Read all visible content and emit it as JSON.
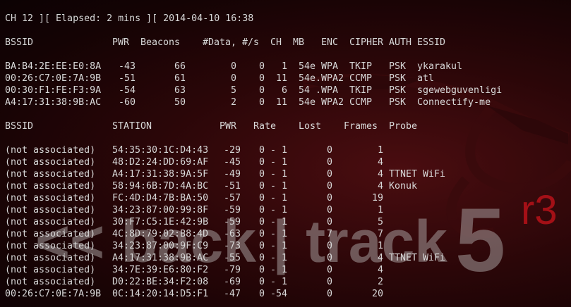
{
  "status_line": "CH 12 ][ Elapsed: 2 mins ][ 2014-04-10 16:38",
  "ap_table": {
    "headers": [
      "BSSID",
      "PWR",
      "Beacons",
      "#Data,",
      "#/s",
      "CH",
      "MB",
      "ENC",
      "CIPHER",
      "AUTH",
      "ESSID"
    ],
    "rows": [
      [
        "BA:B4:2E:EE:E0:8A",
        "-43",
        "66",
        "0",
        "0",
        "1",
        "54e",
        "WPA",
        "TKIP",
        "PSK",
        "ykarakul"
      ],
      [
        "00:26:C7:0E:7A:9B",
        "-51",
        "61",
        "0",
        "0",
        "11",
        "54e.",
        "WPA2",
        "CCMP",
        "PSK",
        "atl"
      ],
      [
        "00:30:F1:FE:F3:9A",
        "-54",
        "63",
        "5",
        "0",
        "6",
        "54 .",
        "WPA",
        "TKIP",
        "PSK",
        "sgewebguvenligi"
      ],
      [
        "A4:17:31:38:9B:AC",
        "-60",
        "50",
        "2",
        "0",
        "11",
        "54e",
        "WPA2",
        "CCMP",
        "PSK",
        "Connectify-me"
      ]
    ]
  },
  "station_table": {
    "headers": [
      "BSSID",
      "STATION",
      "PWR",
      "Rate",
      "Lost",
      "Frames",
      "Probe"
    ],
    "rows": [
      [
        "(not associated)",
        "54:35:30:1C:D4:43",
        "-29",
        "0 - 1",
        "0",
        "1",
        ""
      ],
      [
        "(not associated)",
        "48:D2:24:DD:69:AF",
        "-45",
        "0 - 1",
        "0",
        "4",
        ""
      ],
      [
        "(not associated)",
        "A4:17:31:38:9A:5F",
        "-49",
        "0 - 1",
        "0",
        "4",
        "TTNET WiFi"
      ],
      [
        "(not associated)",
        "58:94:6B:7D:4A:BC",
        "-51",
        "0 - 1",
        "0",
        "4",
        "Konuk"
      ],
      [
        "(not associated)",
        "FC:4D:D4:7B:BA:50",
        "-57",
        "0 - 1",
        "0",
        "19",
        ""
      ],
      [
        "(not associated)",
        "34:23:87:00:99:8F",
        "-59",
        "0 - 1",
        "0",
        "1",
        ""
      ],
      [
        "(not associated)",
        "30:F7:C5:1E:42:9B",
        "-59",
        "0 - 1",
        "0",
        "5",
        ""
      ],
      [
        "(not associated)",
        "4C:8D:79:02:B8:4D",
        "-63",
        "0 - 1",
        "7",
        "7",
        ""
      ],
      [
        "(not associated)",
        "34:23:87:00:9F:C9",
        "-73",
        "0 - 1",
        "0",
        "1",
        ""
      ],
      [
        "(not associated)",
        "A4:17:31:38:9B:AC",
        "-55",
        "0 - 1",
        "0",
        "4",
        "TTNET WiFi"
      ],
      [
        "(not associated)",
        "34:7E:39:E6:80:F2",
        "-79",
        "0 - 1",
        "0",
        "4",
        ""
      ],
      [
        "(not associated)",
        "D0:22:BE:34:F2:08",
        "-69",
        "0 - 1",
        "0",
        "2",
        ""
      ],
      [
        "00:26:C7:0E:7A:9B",
        "0C:14:20:14:D5:F1",
        "-47",
        "0 -54",
        "0",
        "20",
        ""
      ]
    ]
  },
  "wallpaper": {
    "logo_text": "<< back | track",
    "version_number": "5",
    "version_suffix": "r3"
  },
  "colors": {
    "background": "#1a0405",
    "text": "#d8d8d8",
    "logo": "#9a8f8f",
    "logo_accent": "#c0121a"
  }
}
